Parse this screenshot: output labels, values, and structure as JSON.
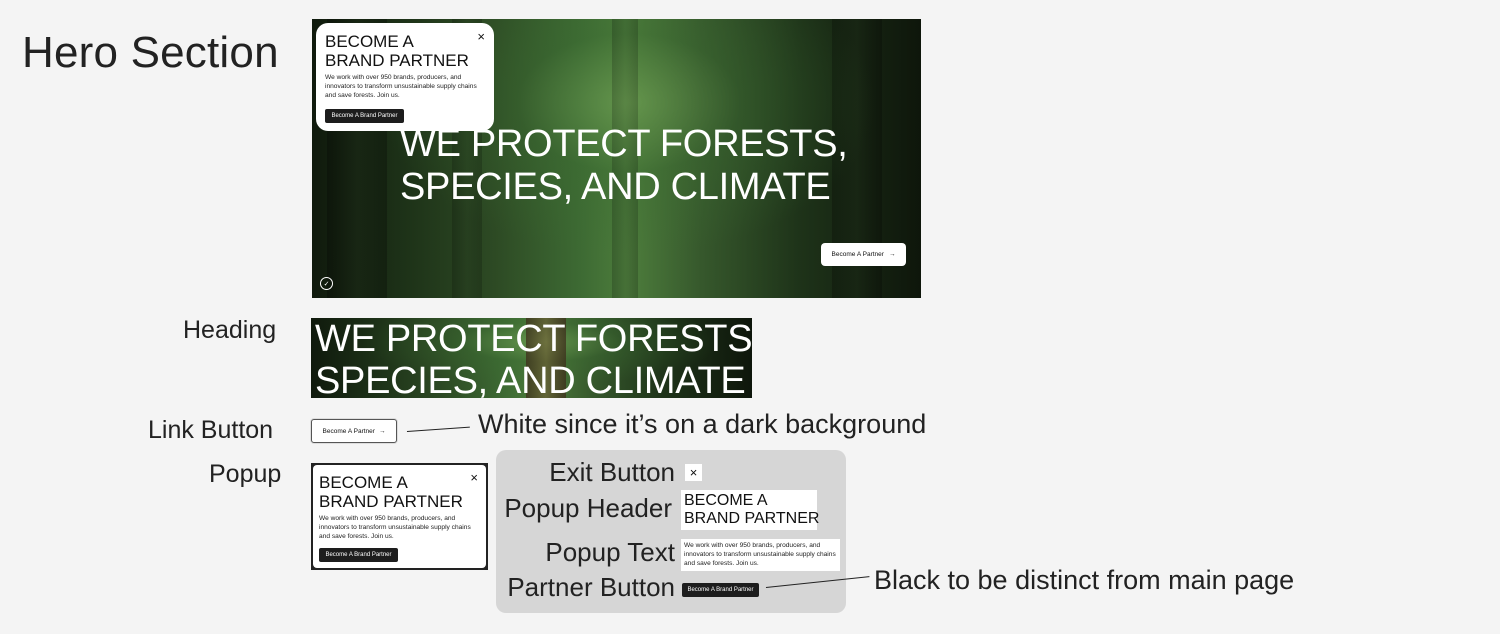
{
  "page": {
    "title": "Hero Section"
  },
  "hero": {
    "heading_line1": "WE PROTECT FORESTS,",
    "heading_line2": "SPECIES, AND CLIMATE",
    "link_label": "Become A Partner",
    "link_arrow": "→",
    "logo_glyph": "✓"
  },
  "popup": {
    "header_line1": "BECOME A",
    "header_line2": "BRAND PARTNER",
    "text": "We work with over 950 brands, producers, and innovators to transform unsustainable supply chains and save forests. Join us.",
    "button_label": "Become A Brand Partner",
    "close_glyph": "×"
  },
  "labels": {
    "heading": "Heading",
    "link_button": "Link Button",
    "popup": "Popup",
    "exit_button": "Exit Button",
    "popup_header": "Popup Header",
    "popup_text": "Popup Text",
    "partner_button": "Partner Button"
  },
  "annotations": {
    "link_note": "White since it’s on a dark background",
    "partner_note": "Black to be distinct from main page"
  },
  "link_sample": {
    "label": "Become A Partner",
    "arrow": "→"
  },
  "colors": {
    "background": "#f4f4f4",
    "panel": "#d6d6d6",
    "button_dark": "#1d1d1d",
    "text_white": "#ffffff"
  }
}
